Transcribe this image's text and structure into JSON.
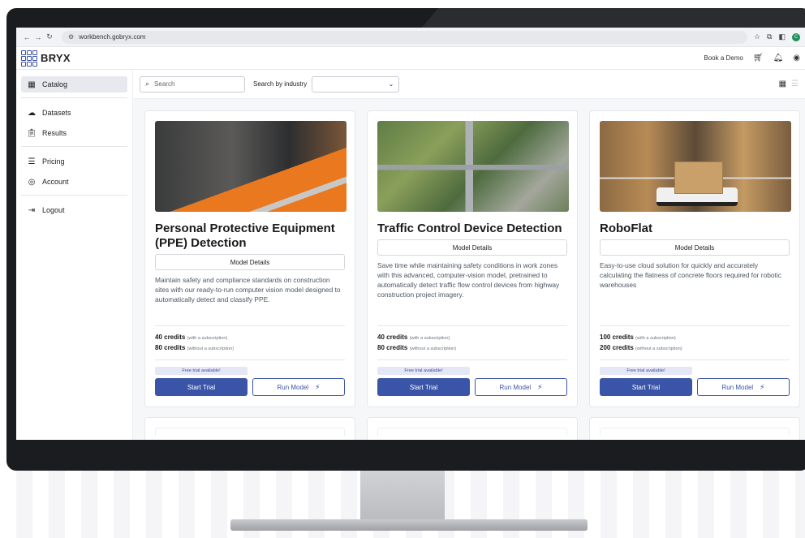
{
  "browser": {
    "url": "workbench.gobryx.com"
  },
  "app": {
    "logo_text": "BRYX",
    "book_demo": "Book a Demo"
  },
  "sidebar": {
    "items": [
      {
        "label": "Catalog",
        "icon": "storefront-icon",
        "active": true
      },
      {
        "label": "Datasets",
        "icon": "cloud-upload-icon"
      },
      {
        "label": "Results",
        "icon": "clipboard-icon"
      },
      {
        "label": "Pricing",
        "icon": "stack-icon"
      },
      {
        "label": "Account",
        "icon": "user-circle-icon"
      },
      {
        "label": "Logout",
        "icon": "logout-icon"
      }
    ]
  },
  "toolbar": {
    "search_placeholder": "Search",
    "industry_label": "Search by industry"
  },
  "cards": [
    {
      "title": "Personal Protective Equipment (PPE) Detection",
      "details_label": "Model Details",
      "description": "Maintain safety and compliance standards on construction sites with our ready-to-run computer vision model designed to automatically detect and classify PPE.",
      "price_sub": "40 credits",
      "price_sub_note": "(with a subscription)",
      "price_nosub": "80 credits",
      "price_nosub_note": "(without a subscription)",
      "trial_badge": "Free trial available!",
      "start_label": "Start Trial",
      "run_label": "Run Model"
    },
    {
      "title": "Traffic Control Device Detection",
      "details_label": "Model Details",
      "description": "Save time while maintaining safety conditions in work zones with this advanced, computer-vision model, pretrained to automatically detect traffic flow control devices from highway construction project imagery.",
      "price_sub": "40 credits",
      "price_sub_note": "(with a subscription)",
      "price_nosub": "80 credits",
      "price_nosub_note": "(without a subscription)",
      "trial_badge": "Free trial available!",
      "start_label": "Start Trial",
      "run_label": "Run Model"
    },
    {
      "title": "RoboFlat",
      "details_label": "Model Details",
      "description": "Easy-to-use cloud solution for quickly and accurately calculating the flatness of concrete floors required for robotic warehouses",
      "price_sub": "100 credits",
      "price_sub_note": "(with a subscription)",
      "price_nosub": "200 credits",
      "price_nosub_note": "(without a subscription)",
      "trial_badge": "Free trial available!",
      "start_label": "Start Trial",
      "run_label": "Run Model"
    }
  ],
  "colors": {
    "primary": "#3a55a8",
    "badge_bg": "#e5e7f6"
  }
}
